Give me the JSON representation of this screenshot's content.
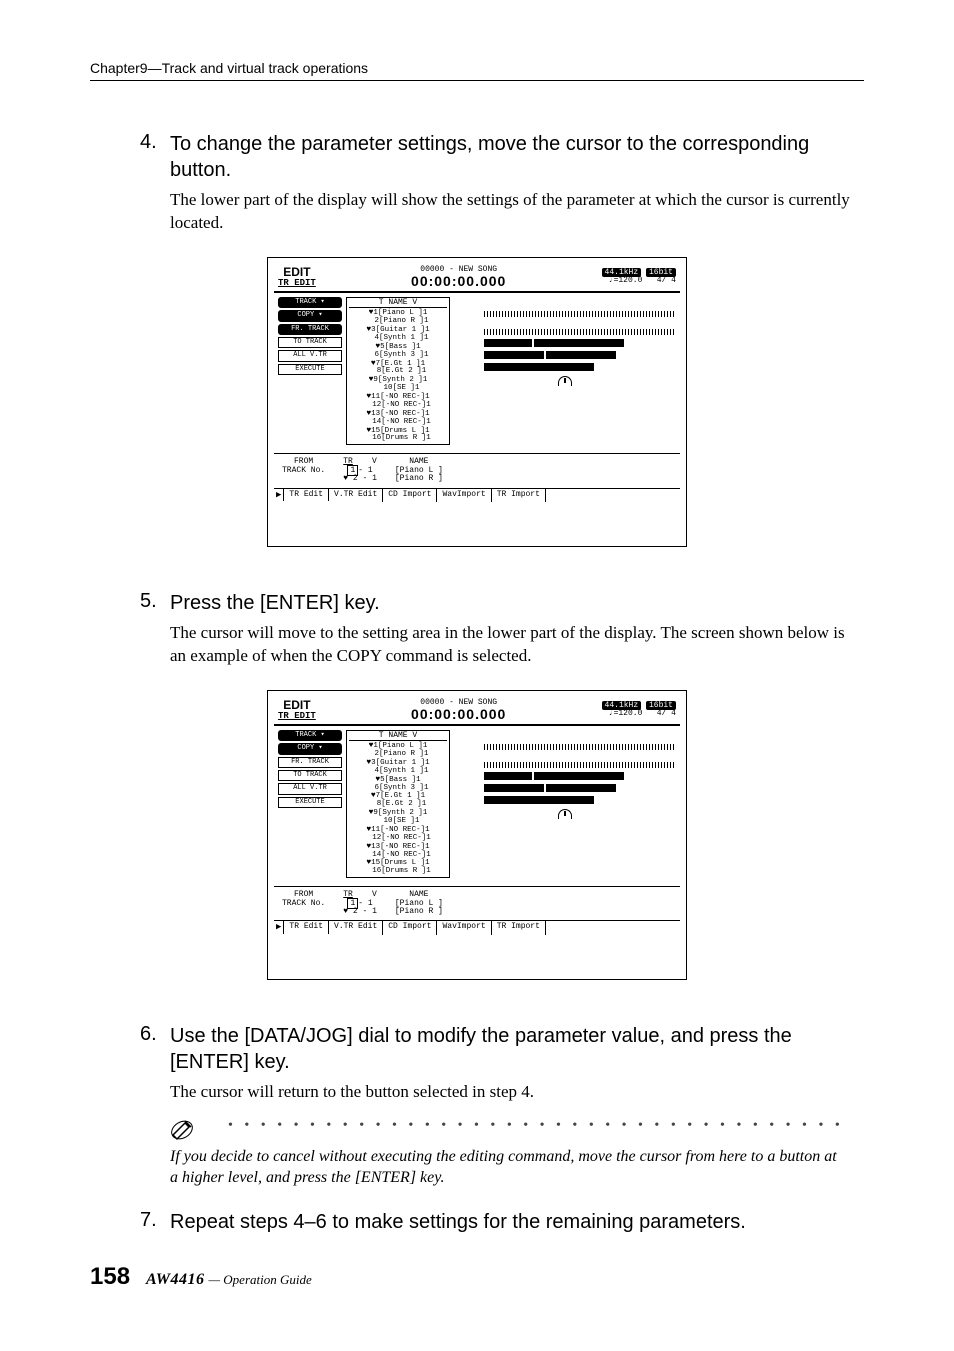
{
  "chapter": "Chapter9—Track and virtual track operations",
  "steps": {
    "s4": {
      "num": "4.",
      "title": "To change the parameter settings, move the cursor to the corresponding button.",
      "explain": "The lower part of the display will show the settings of the parameter at which the cursor is currently located."
    },
    "s5": {
      "num": "5.",
      "title": "Press the [ENTER] key.",
      "explain": "The cursor will move to the setting area in the lower part of the display. The screen shown below is an example of when the COPY command is selected."
    },
    "s6": {
      "num": "6.",
      "title": "Use the [DATA/JOG] dial to modify the parameter value, and press the [ENTER] key.",
      "explain": "The cursor will return to the button selected in step 4."
    },
    "s7": {
      "num": "7.",
      "title": "Repeat steps 4–6 to make settings for the remaining parameters."
    }
  },
  "note": {
    "dots": "• • • • • • • • • • • • • • • • • • • • • • • • • • • • • • • • • • • • • • • • • • •",
    "text": "If you decide to cancel without executing the editing command, move the cursor from here to a button at a higher level, and press the [ENTER] key."
  },
  "lcd": {
    "title_label": "EDIT",
    "subtitle": "TR EDIT",
    "song": "00000 - NEW SONG",
    "time": "00:00:00.000",
    "rate": "44.1kHz",
    "bits": "16bit",
    "tempo": "♩=120.0",
    "counter": "4/ 4",
    "left_buttons": [
      "TRACK ▾",
      "COPY ▾",
      "FR. TRACK",
      "TO  TRACK",
      "ALL V.TR",
      "EXECUTE"
    ],
    "track_header": "T    NAME    V",
    "tracks": [
      "1[Piano L  ]1",
      "2[Piano R  ]1",
      "3[Guitar 1 ]1",
      "4[Synth 1  ]1",
      "5[Bass     ]1",
      "6[Synth 3  ]1",
      "7[E.Gt 1   ]1",
      "8[E.Gt 2   ]1",
      "9[Synth 2  ]1",
      "10[SE      ]1",
      "11[-NO REC-]1",
      "12[-NO REC-]1",
      "13[-NO REC-]1",
      "14[-NO REC-]1",
      "15[Drums L ]1",
      "16[Drums R ]1"
    ],
    "lower": {
      "from": "FROM",
      "track_no_label": "TRACK No.",
      "tr_label": "TR",
      "v_label": "V",
      "row1_tr": "1",
      "row1_v": "- 1",
      "row2_tr": "2",
      "row2_v": "- 1",
      "name_label": "NAME",
      "name1": "[Piano L        ]",
      "name2": "[Piano R        ]"
    },
    "tabs": [
      "TR Edit",
      "V.TR Edit",
      "CD Import",
      "WavImport",
      "TR Import"
    ]
  },
  "footer": {
    "page": "158",
    "brand": "AW4416",
    "guide": "— Operation Guide"
  }
}
